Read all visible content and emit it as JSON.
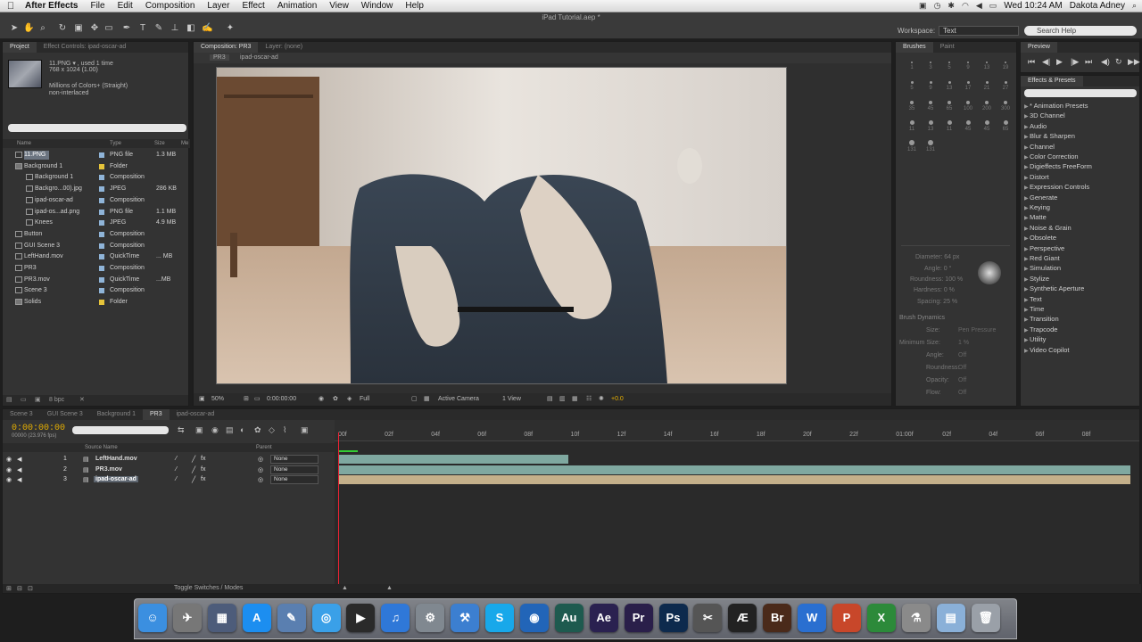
{
  "menubar": {
    "app": "After Effects",
    "items": [
      "File",
      "Edit",
      "Composition",
      "Layer",
      "Effect",
      "Animation",
      "View",
      "Window",
      "Help"
    ],
    "clock": "Wed 10:24 AM",
    "user": "Dakota Adney"
  },
  "window": {
    "title": "iPad Tutorial.aep *"
  },
  "toolbar": {
    "workspace_label": "Workspace:",
    "workspace_value": "Text",
    "search_placeholder": "Search Help"
  },
  "project": {
    "tabs": [
      "Project",
      "Effect Controls: ipad-oscar-ad"
    ],
    "info": {
      "name": "11.PNG ▾ , used 1 time",
      "dimensions": "768 x 1024 (1.00)",
      "colors": "Millions of Colors+ (Straight)",
      "interlace": "non-interlaced"
    },
    "columns": [
      "Name",
      "Type",
      "Size",
      "Me"
    ],
    "items": [
      {
        "name": "11.PNG",
        "type": "PNG file",
        "size": "1.3 MB",
        "label": "#8fb4d8",
        "indent": 0,
        "selected": true
      },
      {
        "name": "Background 1",
        "type": "Folder",
        "size": "",
        "label": "#e6c43a",
        "indent": 0
      },
      {
        "name": "Background 1",
        "type": "Composition",
        "size": "",
        "label": "#8fb4d8",
        "indent": 1
      },
      {
        "name": "Backgro...00).jpg",
        "type": "JPEG",
        "size": "286 KB",
        "label": "#8fb4d8",
        "indent": 1
      },
      {
        "name": "ipad-oscar-ad",
        "type": "Composition",
        "size": "",
        "label": "#8fb4d8",
        "indent": 1
      },
      {
        "name": "ipad-os...ad.png",
        "type": "PNG file",
        "size": "1.1 MB",
        "label": "#8fb4d8",
        "indent": 1
      },
      {
        "name": "Knees",
        "type": "JPEG",
        "size": "4.9 MB",
        "label": "#8fb4d8",
        "indent": 1
      },
      {
        "name": "Button",
        "type": "Composition",
        "size": "",
        "label": "#8fb4d8",
        "indent": 0
      },
      {
        "name": "GUI Scene 3",
        "type": "Composition",
        "size": "",
        "label": "#8fb4d8",
        "indent": 0
      },
      {
        "name": "LeftHand.mov",
        "type": "QuickTime",
        "size": "... MB",
        "label": "#8fb4d8",
        "indent": 0
      },
      {
        "name": "PR3",
        "type": "Composition",
        "size": "",
        "label": "#8fb4d8",
        "indent": 0
      },
      {
        "name": "PR3.mov",
        "type": "QuickTime",
        "size": "...MB",
        "label": "#8fb4d8",
        "indent": 0
      },
      {
        "name": "Scene 3",
        "type": "Composition",
        "size": "",
        "label": "#8fb4d8",
        "indent": 0
      },
      {
        "name": "Solids",
        "type": "Folder",
        "size": "",
        "label": "#e6c43a",
        "indent": 0
      }
    ],
    "footer_bpc": "8 bpc"
  },
  "composition": {
    "tab": "Composition: PR3",
    "layer_tab": "Layer: (none)",
    "breadcrumbs": [
      "PR3",
      "ipad-oscar-ad"
    ],
    "zoom": "50%",
    "timecode": "0:00:00:00",
    "resolution": "Full",
    "camera": "Active Camera",
    "view": "1 View",
    "exposure": "+0.0"
  },
  "brushes": {
    "tabs": [
      "Brushes",
      "Paint"
    ],
    "sizes": [
      "1",
      "3",
      "5",
      "9",
      "13",
      "19",
      "5",
      "9",
      "13",
      "17",
      "21",
      "27",
      "35",
      "45",
      "65",
      "100",
      "200",
      "300",
      "11",
      "13",
      "11",
      "45",
      "45",
      "65",
      "131",
      "131"
    ],
    "diameter": "Diameter: 64 px",
    "angle": "Angle: 0 °",
    "roundness": "Roundness: 100 %",
    "hardness": "Hardness: 0 %",
    "spacing": "Spacing: 25 %",
    "dynamics_title": "Brush Dynamics",
    "dynamics": [
      {
        "label": "Size:",
        "value": "Pen Pressure"
      },
      {
        "label": "Minimum Size:",
        "value": "1 %"
      },
      {
        "label": "Angle:",
        "value": "Off"
      },
      {
        "label": "Roundness:",
        "value": "Off"
      },
      {
        "label": "Opacity:",
        "value": "Off"
      },
      {
        "label": "Flow:",
        "value": "Off"
      }
    ]
  },
  "preview": {
    "tab": "Preview"
  },
  "effects": {
    "tab": "Effects & Presets",
    "items": [
      "* Animation Presets",
      "3D Channel",
      "Audio",
      "Blur & Sharpen",
      "Channel",
      "Color Correction",
      "Digieffects FreeForm",
      "Distort",
      "Expression Controls",
      "Generate",
      "Keying",
      "Matte",
      "Noise & Grain",
      "Obsolete",
      "Perspective",
      "Red Giant",
      "Simulation",
      "Stylize",
      "Synthetic Aperture",
      "Text",
      "Time",
      "Transition",
      "Trapcode",
      "Utility",
      "Video Copilot"
    ]
  },
  "timeline": {
    "tabs": [
      "Scene 3",
      "GUI Scene 3",
      "Background 1",
      "PR3",
      "ipad-oscar-ad"
    ],
    "active_tab": 3,
    "timecode": "0:00:00:00",
    "timecode_sub": "00000 (23.976 fps)",
    "columns": {
      "source": "Source Name",
      "parent": "Parent"
    },
    "layers": [
      {
        "num": "1",
        "name": "LeftHand.mov",
        "parent": "None"
      },
      {
        "num": "2",
        "name": "PR3.mov",
        "parent": "None"
      },
      {
        "num": "3",
        "name": "ipad-oscar-ad",
        "parent": "None",
        "selected": true
      }
    ],
    "ruler": [
      "00f",
      "02f",
      "04f",
      "06f",
      "08f",
      "10f",
      "12f",
      "14f",
      "16f",
      "18f",
      "20f",
      "22f",
      "01:00f",
      "02f",
      "04f",
      "06f",
      "08f"
    ],
    "footer": "Toggle Switches / Modes"
  },
  "dock": {
    "apps": [
      {
        "name": "finder-icon",
        "glyph": "☺",
        "color": "#3b8fe0"
      },
      {
        "name": "launchpad-icon",
        "glyph": "✈",
        "color": "#777"
      },
      {
        "name": "mission-control-icon",
        "glyph": "▦",
        "color": "#4d5c7a"
      },
      {
        "name": "app-store-icon",
        "glyph": "A",
        "color": "#1c8ef0"
      },
      {
        "name": "preview-icon",
        "glyph": "✎",
        "color": "#5a7fb0"
      },
      {
        "name": "safari-icon",
        "glyph": "◎",
        "color": "#3aa0e8"
      },
      {
        "name": "facetime-icon",
        "glyph": "▶",
        "color": "#2a2a2a"
      },
      {
        "name": "itunes-icon",
        "glyph": "♫",
        "color": "#2f78d8"
      },
      {
        "name": "system-preferences-icon",
        "glyph": "⚙",
        "color": "#808890"
      },
      {
        "name": "xcode-icon",
        "glyph": "⚒",
        "color": "#3c7fd0"
      },
      {
        "name": "skype-icon",
        "glyph": "S",
        "color": "#18a8ea"
      },
      {
        "name": "network-icon",
        "glyph": "◉",
        "color": "#2265b8"
      },
      {
        "name": "audition-icon",
        "glyph": "Au",
        "color": "#1e5a4f"
      },
      {
        "name": "after-effects-icon",
        "glyph": "Ae",
        "color": "#2a2150"
      },
      {
        "name": "premiere-icon",
        "glyph": "Pr",
        "color": "#2a1f4a"
      },
      {
        "name": "photoshop-icon",
        "glyph": "Ps",
        "color": "#0d2a4d"
      },
      {
        "name": "clapper-icon",
        "glyph": "✂",
        "color": "#555"
      },
      {
        "name": "ae-logo-icon",
        "glyph": "Æ",
        "color": "#222"
      },
      {
        "name": "bridge-icon",
        "glyph": "Br",
        "color": "#4a2a1a"
      },
      {
        "name": "word-icon",
        "glyph": "W",
        "color": "#2a6fd0"
      },
      {
        "name": "powerpoint-icon",
        "glyph": "P",
        "color": "#c8472a"
      },
      {
        "name": "excel-icon",
        "glyph": "X",
        "color": "#2c8a3a"
      },
      {
        "name": "utility-icon",
        "glyph": "⚗",
        "color": "#8a8a8a"
      },
      {
        "name": "documents-folder-icon",
        "glyph": "▤",
        "color": "#8ab0d8"
      },
      {
        "name": "trash-icon",
        "glyph": "🗑",
        "color": "#9aa0a8"
      }
    ]
  }
}
